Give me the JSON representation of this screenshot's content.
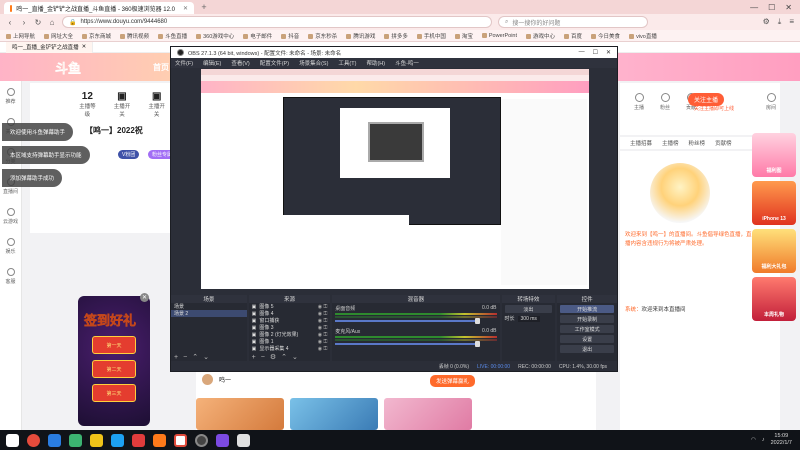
{
  "browser": {
    "active_tab": "鸣一_直播_金铲铲之战直播_斗鱼直播 - 360极速浏览器 12.0",
    "url": "https://www.douyu.com/9444680",
    "search_placeholder": "搜一搜你的好问题",
    "bookmarks": [
      "上网导航",
      "网址大全",
      "京东商城",
      "腾讯视频",
      "斗鱼直播",
      "360游戏中心",
      "电子邮件",
      "抖音",
      "京东秒杀",
      "腾讯游戏",
      "拼多多",
      "手机中国",
      "淘宝",
      "PowerPoint",
      "游戏中心",
      "百度",
      "今日美食",
      "vivo直播"
    ],
    "page_tab": "鸣一_直播_金铲铲之战直播"
  },
  "page": {
    "home_link": "首页",
    "stats": [
      {
        "value": "12",
        "label": "主播等级"
      },
      {
        "value": "",
        "label": "主播开关"
      },
      {
        "value": "",
        "label": "主播开关"
      }
    ],
    "room_title": "【鸣一】2022祝",
    "level_badge": "V粉团",
    "level_badge2": "粉丝专属",
    "toasts": [
      "欢迎使用斗鱼弹幕助手",
      "本区域支持弹幕助手显示功能",
      "添加弹幕助手成功"
    ],
    "promo": {
      "title": "签到好礼",
      "coupons": [
        "第一天",
        "第二天",
        "第三天"
      ]
    },
    "chat_user": "鸣一",
    "gift_button": "发送弹幕赢礼",
    "left_nav": [
      "推荐",
      "关注",
      "分类",
      "直播间",
      "云游戏",
      "娱乐",
      "客服"
    ],
    "right_head": [
      "主播",
      "粉丝",
      "贡献",
      "房间"
    ],
    "follow_button": "关注主播",
    "follow_sub": "关注主播即可上线",
    "right_tabs": [
      "主播招募",
      "主播榜",
      "粉丝榜",
      "贡献榜"
    ],
    "notice": "欢迎来到【鸣一】的直播间。斗鱼倡导绿色直播，直播内容含违规行为将被严肃处理。",
    "welcome_prefix": "系统：",
    "welcome_text": "欢迎来到本直播间",
    "sidebar_ads": [
      "福利图",
      "iPhone 13",
      "福利大礼包",
      "本周礼物"
    ]
  },
  "obs": {
    "title": "OBS 27.1.3 (64 bit, windows) - 配置文件: 未命名 - 场景: 未命名",
    "menu": [
      "文件(F)",
      "编辑(E)",
      "查看(V)",
      "配置文件(P)",
      "场景集合(S)",
      "工具(T)",
      "帮助(H)",
      "斗鱼-鸣一"
    ],
    "docks": {
      "scenes": "场景",
      "sources": "来源",
      "mixer": "混音器",
      "transitions": "转场特效",
      "controls": "控件"
    },
    "scenes": [
      "场景",
      "场景 2"
    ],
    "sources": [
      "图像 5",
      "图像 4",
      "窗口捕获",
      "图像 3",
      "图像 2 (灯光效果)",
      "图像 1",
      "显示器采集 4"
    ],
    "mixer": [
      {
        "name": "桌面音频",
        "db": "0.0 dB"
      },
      {
        "name": "麦克风/Aux",
        "db": "0.0 dB"
      }
    ],
    "transition": {
      "type": "淡出",
      "duration_label": "时长",
      "duration": "300 ms"
    },
    "controls": [
      "开始推流",
      "开始录制",
      "工作室模式",
      "设置",
      "退出"
    ],
    "status": {
      "dropped": "丢帧 0 (0.0%)",
      "live": "LIVE: 00:00:00",
      "rec": "REC: 00:00:00",
      "cpu": "CPU: 1.4%, 30.00 fps"
    }
  },
  "taskbar": {
    "time": "15:09",
    "date": "2022/1/7"
  }
}
